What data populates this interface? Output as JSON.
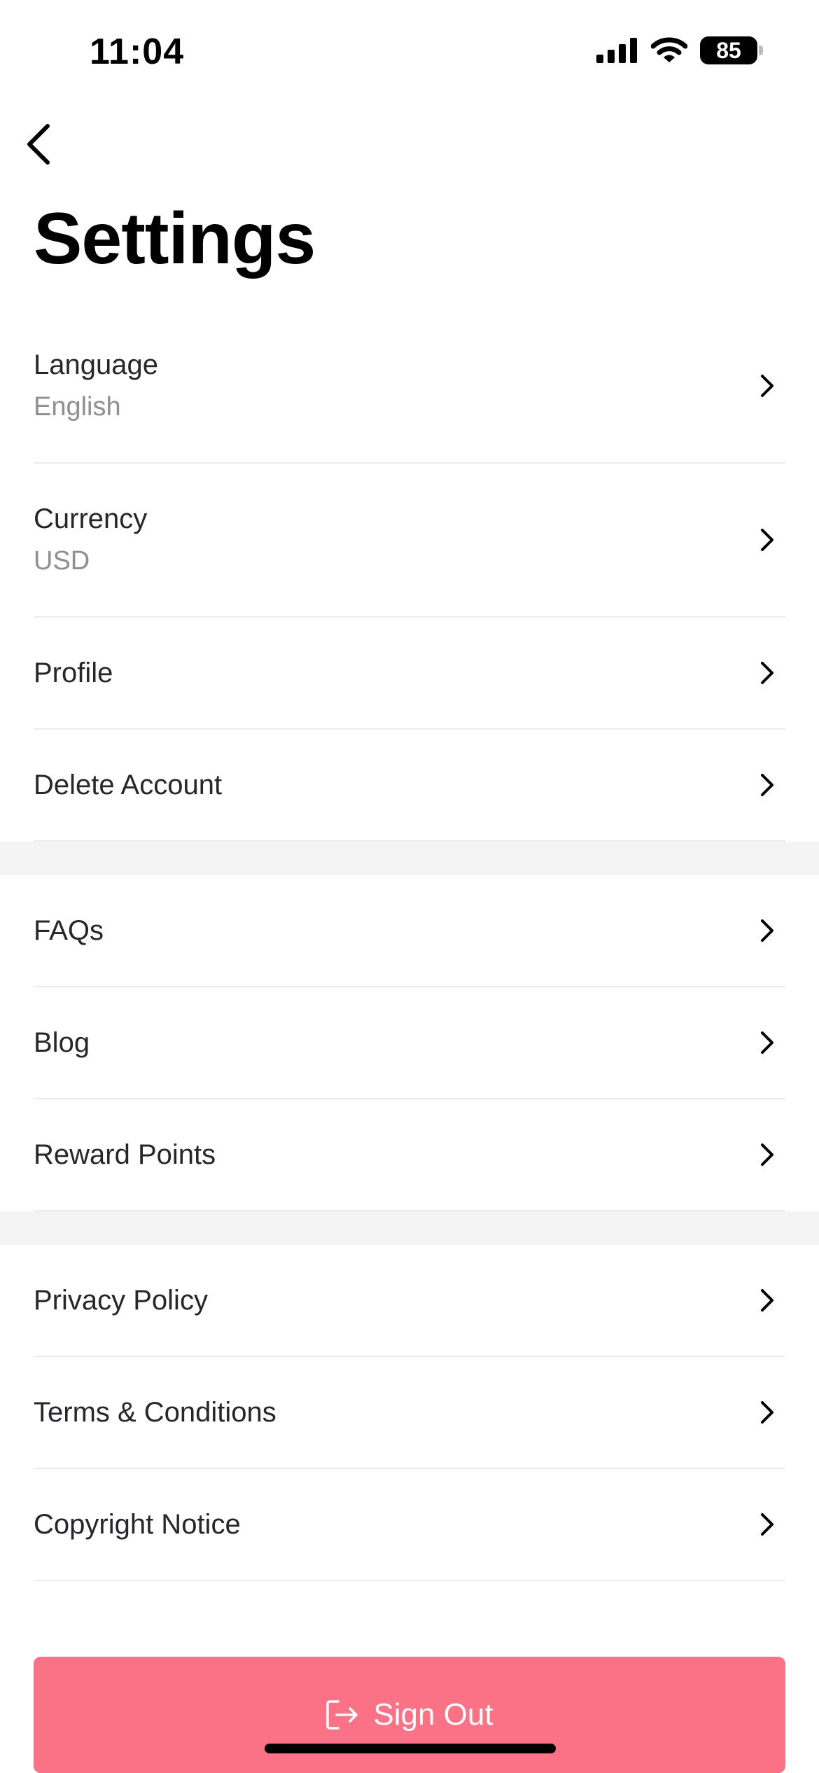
{
  "status_bar": {
    "time": "11:04",
    "battery": "85",
    "icons": [
      "cellular-signal-icon",
      "wifi-icon",
      "battery-icon"
    ]
  },
  "header": {
    "back_icon": "chevron-left-icon",
    "title": "Settings"
  },
  "groups": [
    {
      "items": [
        {
          "label": "Language",
          "value": "English"
        },
        {
          "label": "Currency",
          "value": "USD"
        },
        {
          "label": "Profile"
        },
        {
          "label": "Delete Account"
        }
      ]
    },
    {
      "items": [
        {
          "label": "FAQs"
        },
        {
          "label": "Blog"
        },
        {
          "label": "Reward Points"
        }
      ]
    },
    {
      "items": [
        {
          "label": "Privacy Policy"
        },
        {
          "label": "Terms & Conditions"
        },
        {
          "label": "Copyright Notice"
        }
      ]
    }
  ],
  "sign_out": {
    "label": "Sign Out",
    "icon": "sign-out-icon"
  },
  "colors": {
    "accent": "#fb7186",
    "divider": "#ececec",
    "group_band": "#f4f4f4",
    "secondary_text": "#8e8e93"
  }
}
